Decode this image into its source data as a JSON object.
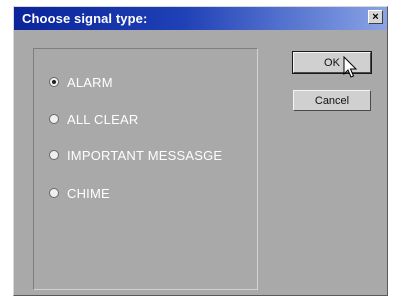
{
  "dialog": {
    "title": "Choose signal type:",
    "close_glyph": "×",
    "options": [
      {
        "label": "ALARM",
        "checked": true
      },
      {
        "label": "ALL CLEAR",
        "checked": false
      },
      {
        "label": "IMPORTANT MESSASGE",
        "checked": false
      },
      {
        "label": "CHIME",
        "checked": false
      }
    ],
    "ok_label": "OK",
    "cancel_label": "Cancel"
  },
  "colors": {
    "titlebar_start": "#0b249c",
    "titlebar_end": "#8aa4e6",
    "dialog_bg": "#a9a9a9"
  },
  "icons": {
    "cursor": "arrow-pointer-icon",
    "close": "close-icon"
  }
}
